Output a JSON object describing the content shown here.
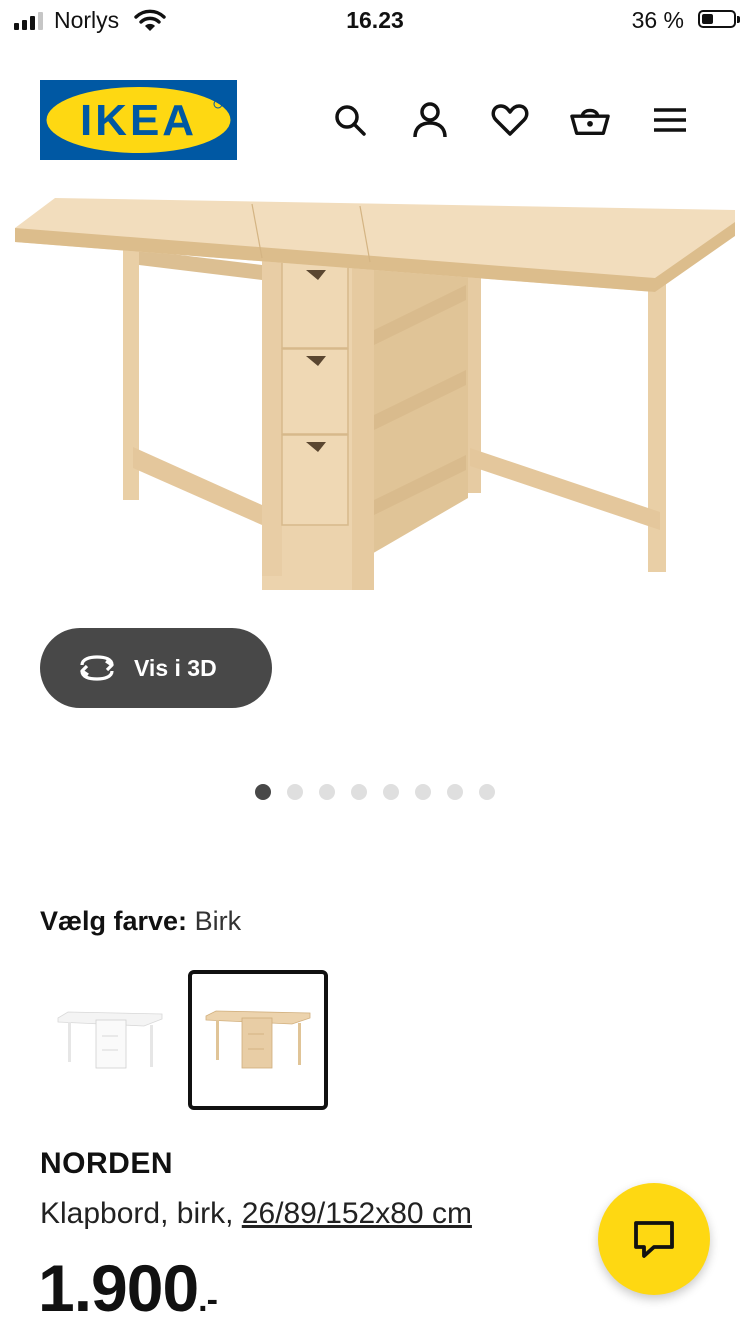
{
  "status_bar": {
    "carrier": "Norlys",
    "time": "16.23",
    "battery_text": "36 %",
    "battery_level": 0.36
  },
  "header": {
    "logo_text": "IKEA",
    "icons": [
      "search-icon",
      "account-icon",
      "heart-icon",
      "basket-icon",
      "menu-icon"
    ]
  },
  "hero": {
    "view_3d_label": "Vis i 3D",
    "image_count": 8,
    "active_image": 1
  },
  "color_picker": {
    "label": "Vælg farve:",
    "selected": "Birk",
    "options_selected_index": 1
  },
  "product": {
    "name": "NORDEN",
    "description": "Klapbord, birk,",
    "size_link": "26/89/152x80 cm",
    "price": "1.900",
    "price_suffix": ".-"
  },
  "colors": {
    "ikea_blue": "#0058a3",
    "ikea_yellow": "#fed812",
    "button_dark": "#484848",
    "birch": "#ecd3ad"
  }
}
